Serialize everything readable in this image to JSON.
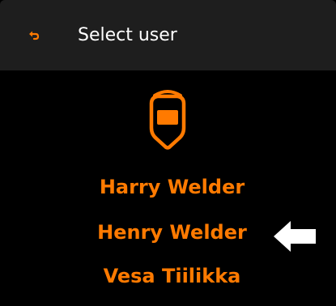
{
  "header": {
    "title": "Select user",
    "back_icon": "back-arrow-icon"
  },
  "users": [
    {
      "label": "Harry Welder"
    },
    {
      "label": "Henry Welder"
    },
    {
      "label": "Vesa Tiilikka"
    }
  ],
  "selected_index": 1,
  "icons": {
    "user": "welding-helmet-icon",
    "pointer": "selection-arrow-icon"
  },
  "colors": {
    "accent": "#ff7a00",
    "header_bg": "#1e1e1e",
    "background": "#000000",
    "title_text": "#ffffff",
    "pointer": "#ffffff"
  }
}
